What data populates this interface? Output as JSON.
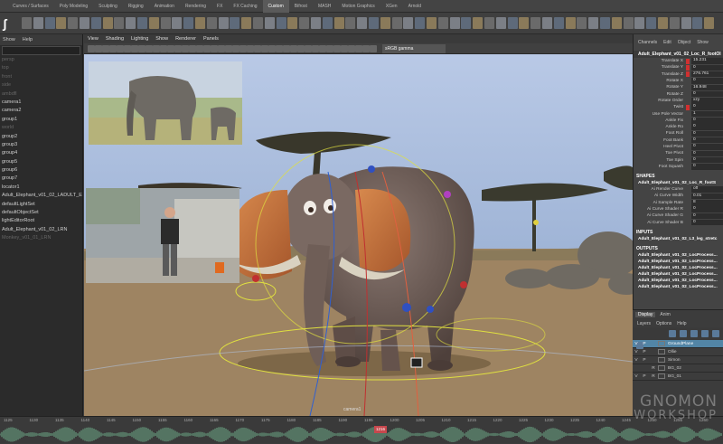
{
  "shelf": {
    "tabs": [
      "Curves / Surfaces",
      "Poly Modeling",
      "Sculpting",
      "Rigging",
      "Animation",
      "Rendering",
      "FX",
      "FX Caching",
      "Custom",
      "Bifrost",
      "MASH",
      "Motion Graphics",
      "XGen",
      "Arnold"
    ],
    "active_tab": "Custom"
  },
  "logo": "ʃ",
  "outliner": {
    "menu": [
      "Show",
      "Help"
    ],
    "items": [
      {
        "label": "persp",
        "dim": true
      },
      {
        "label": "top",
        "dim": true
      },
      {
        "label": "front",
        "dim": true
      },
      {
        "label": "side",
        "dim": true
      },
      {
        "label": "ambdfl",
        "dim": true
      },
      {
        "label": "camera1",
        "dim": false
      },
      {
        "label": "camera2",
        "dim": false
      },
      {
        "label": "group1",
        "dim": false
      },
      {
        "label": "world",
        "dim": true
      },
      {
        "label": "group2",
        "dim": false
      },
      {
        "label": "group3",
        "dim": false
      },
      {
        "label": "group4",
        "dim": false
      },
      {
        "label": "group5",
        "dim": false
      },
      {
        "label": "group6",
        "dim": false
      },
      {
        "label": "group7",
        "dim": false
      },
      {
        "label": "locator1",
        "dim": false
      },
      {
        "label": "Adult_Elephant_v01_02_LADULT_ELE",
        "dim": false
      },
      {
        "label": "defaultLightSet",
        "dim": false
      },
      {
        "label": "defaultObjectSet",
        "dim": false
      },
      {
        "label": "lightEditorRoot",
        "dim": false
      },
      {
        "label": "Adult_Elephant_v01_02_LRN",
        "dim": false
      },
      {
        "label": "Monkey_v01_01_LRN",
        "dim": true
      }
    ]
  },
  "viewport": {
    "menu": [
      "View",
      "Shading",
      "Lighting",
      "Show",
      "Renderer",
      "Panels"
    ],
    "gamma": "sRGB gamma",
    "camera_label": "camera1"
  },
  "channel_box": {
    "menu": [
      "Channels",
      "Edit",
      "Object",
      "Show"
    ],
    "node": "Adult_Elephant_v01_02_Loc_R_footOI",
    "attributes": [
      {
        "name": "Translate X",
        "value": "15.231",
        "keyed": true
      },
      {
        "name": "Translate Y",
        "value": "0",
        "keyed": true
      },
      {
        "name": "Translate Z",
        "value": "276.761",
        "keyed": true
      },
      {
        "name": "Rotate X",
        "value": "0",
        "keyed": false
      },
      {
        "name": "Rotate Y",
        "value": "16.948",
        "keyed": false
      },
      {
        "name": "Rotate Z",
        "value": "0",
        "keyed": false
      },
      {
        "name": "Rotate Order",
        "value": "xzy",
        "keyed": false
      },
      {
        "name": "Twist",
        "value": "0",
        "keyed": true
      },
      {
        "name": "Use Pole Vector",
        "value": "1",
        "keyed": false
      },
      {
        "name": "Ankle Fix",
        "value": "0",
        "keyed": false
      },
      {
        "name": "Ankle Ro",
        "value": "0",
        "keyed": false
      },
      {
        "name": "Foot Roll",
        "value": "0",
        "keyed": false
      },
      {
        "name": "Foot Bank",
        "value": "0",
        "keyed": false
      },
      {
        "name": "Heel Pivot",
        "value": "0",
        "keyed": false
      },
      {
        "name": "Toe Pivot",
        "value": "0",
        "keyed": false
      },
      {
        "name": "Toe Spin",
        "value": "0",
        "keyed": false
      },
      {
        "name": "Foot Squash",
        "value": "0",
        "keyed": false
      }
    ],
    "shapes_header": "SHAPES",
    "shape_node": "Adult_Elephant_v01_02_Loc_R_footS",
    "shape_attributes": [
      {
        "name": "Ai Render Curve",
        "value": "off"
      },
      {
        "name": "Ai Curve Width",
        "value": "0.01"
      },
      {
        "name": "Ai Sample Rate",
        "value": "8"
      },
      {
        "name": "Ai Curve Shader R",
        "value": "0"
      },
      {
        "name": "Ai Curve Shader G",
        "value": "0"
      },
      {
        "name": "Ai Curve Shader B",
        "value": "0"
      }
    ],
    "inputs_header": "INPUTS",
    "inputs": [
      "Adult_Elephant_v01_02_L3_leg_stretc"
    ],
    "outputs_header": "OUTPUTS",
    "outputs": [
      "Adult_Elephant_v01_02_LocProcess...",
      "Adult_Elephant_v01_02_LocProcess...",
      "Adult_Elephant_v01_02_LocProcess...",
      "Adult_Elephant_v01_02_LocProcess...",
      "Adult_Elephant_v01_02_LocProcess...",
      "Adult_Elephant_v01_02_LocProcess..."
    ]
  },
  "layer_editor": {
    "tabs": [
      "Display",
      "Anim"
    ],
    "active_tab": "Display",
    "menu": [
      "Layers",
      "Options",
      "Help"
    ],
    "layers": [
      {
        "v": "V",
        "p": "P",
        "r": "",
        "name": "GroundPlane",
        "selected": true
      },
      {
        "v": "V",
        "p": "P",
        "r": "",
        "name": "Ollie",
        "selected": false
      },
      {
        "v": "V",
        "p": "P",
        "r": "",
        "name": "Simon",
        "selected": false
      },
      {
        "v": "",
        "p": "",
        "r": "R",
        "name": "BG_02",
        "selected": false
      },
      {
        "v": "V",
        "p": "P",
        "r": "R",
        "name": "BG_01",
        "selected": false
      }
    ]
  },
  "timeline": {
    "ticks": [
      "1125",
      "1130",
      "1135",
      "1140",
      "1145",
      "1150",
      "1155",
      "1160",
      "1165",
      "1170",
      "1175",
      "1180",
      "1185",
      "1190",
      "1195",
      "1200",
      "1205",
      "1210",
      "1215",
      "1220",
      "1225",
      "1230",
      "1235",
      "1240",
      "1245",
      "1250",
      "1255",
      "1260"
    ],
    "current_frame": "1216"
  },
  "watermark": {
    "line1": "GNOMON",
    "line2": "WORKSHOP"
  },
  "colors": {
    "accent": "#5285a6",
    "key": "#d03030",
    "sky": "#a9bfe0",
    "ground": "#9e8462"
  }
}
